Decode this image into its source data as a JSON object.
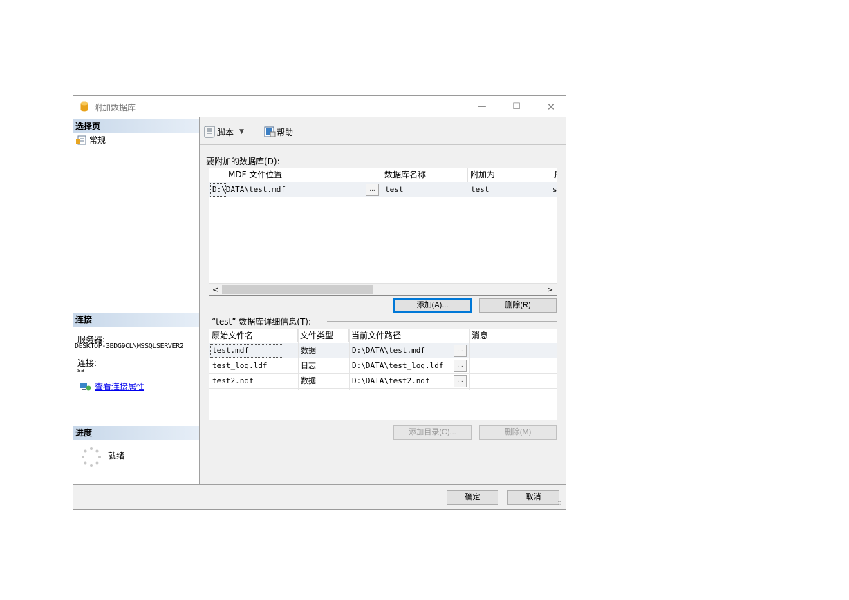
{
  "window": {
    "title": "附加数据库",
    "minimize": "—",
    "maximize": "☐",
    "close": "✕"
  },
  "sidebar": {
    "select_page_header": "选择页",
    "pages": [
      {
        "label": "常规"
      }
    ],
    "connection_header": "连接",
    "server_label": "服务器:",
    "server_value": "DESKTOP-3BDG9CL\\MSSQLSERVER2",
    "connection_label": "连接:",
    "connection_value": "sa",
    "view_conn_props": "查看连接属性",
    "progress_header": "进度",
    "status": "就绪"
  },
  "toolbar": {
    "script_label": "脚本",
    "script_dropdown": "▼",
    "help_label": "帮助"
  },
  "databases": {
    "label": "要附加的数据库(D):",
    "columns": [
      "MDF 文件位置",
      "数据库名称",
      "附加为",
      "所"
    ],
    "rows": [
      {
        "mdf_path": "D:\\DATA\\test.mdf",
        "browse": "...",
        "db_name": "test",
        "attach_as": "test",
        "extra": "s"
      }
    ],
    "scroll_left": "<",
    "scroll_right": ">",
    "add_button": "添加(A)...",
    "remove_button": "删除(R)"
  },
  "details": {
    "label": "“test” 数据库详细信息(T):",
    "columns": [
      "原始文件名",
      "文件类型",
      "当前文件路径",
      "消息"
    ],
    "rows": [
      {
        "name": "test.mdf",
        "type": "数据",
        "path": "D:\\DATA\\test.mdf",
        "browse": "...",
        "message": ""
      },
      {
        "name": "test_log.ldf",
        "type": "日志",
        "path": "D:\\DATA\\test_log.ldf",
        "browse": "...",
        "message": ""
      },
      {
        "name": "test2.ndf",
        "type": "数据",
        "path": "D:\\DATA\\test2.ndf",
        "browse": "...",
        "message": ""
      }
    ],
    "add_catalog_button": "添加目录(C)...",
    "remove_button": "删除(M)"
  },
  "footer": {
    "ok_button": "确定",
    "cancel_button": "取消"
  },
  "icons": {
    "title": "database-cylinder-icon",
    "page": "properties-page-icon",
    "script": "script-scroll-icon",
    "help": "help-book-icon",
    "conn_props": "connection-properties-icon",
    "progress": "progress-spinner-icon"
  },
  "colors": {
    "accent": "#0078d7",
    "sidebar_header": "#c8d8ea",
    "link": "#0000ee"
  }
}
